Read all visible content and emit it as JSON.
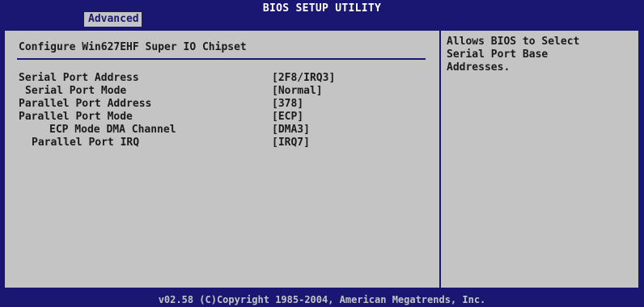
{
  "header": {
    "title": "BIOS SETUP UTILITY",
    "active_tab": "Advanced"
  },
  "main": {
    "section_title": "Configure Win627EHF Super IO Chipset",
    "settings": [
      {
        "label": "Serial Port Address",
        "value": "[2F8/IRQ3]"
      },
      {
        "label": "Serial Port Mode",
        "value": "[Normal]"
      },
      {
        "label": "Parallel Port Address",
        "value": "[378]"
      },
      {
        "label": "Parallel Port Mode",
        "value": "[ECP]"
      },
      {
        "label": "ECP Mode DMA Channel",
        "value": "[DMA3]"
      },
      {
        "label": "Parallel Port IRQ",
        "value": "[IRQ7]"
      }
    ]
  },
  "help": {
    "text": "Allows BIOS to Select\nSerial Port Base\nAddresses."
  },
  "footer": {
    "copyright": "v02.58 (C)Copyright 1985-2004, American Megatrends, Inc."
  },
  "colors": {
    "background_blue": "#1a1773",
    "panel_gray": "#c4c4c4",
    "text_dark": "#1b1b1b",
    "text_white": "#ffffff"
  }
}
